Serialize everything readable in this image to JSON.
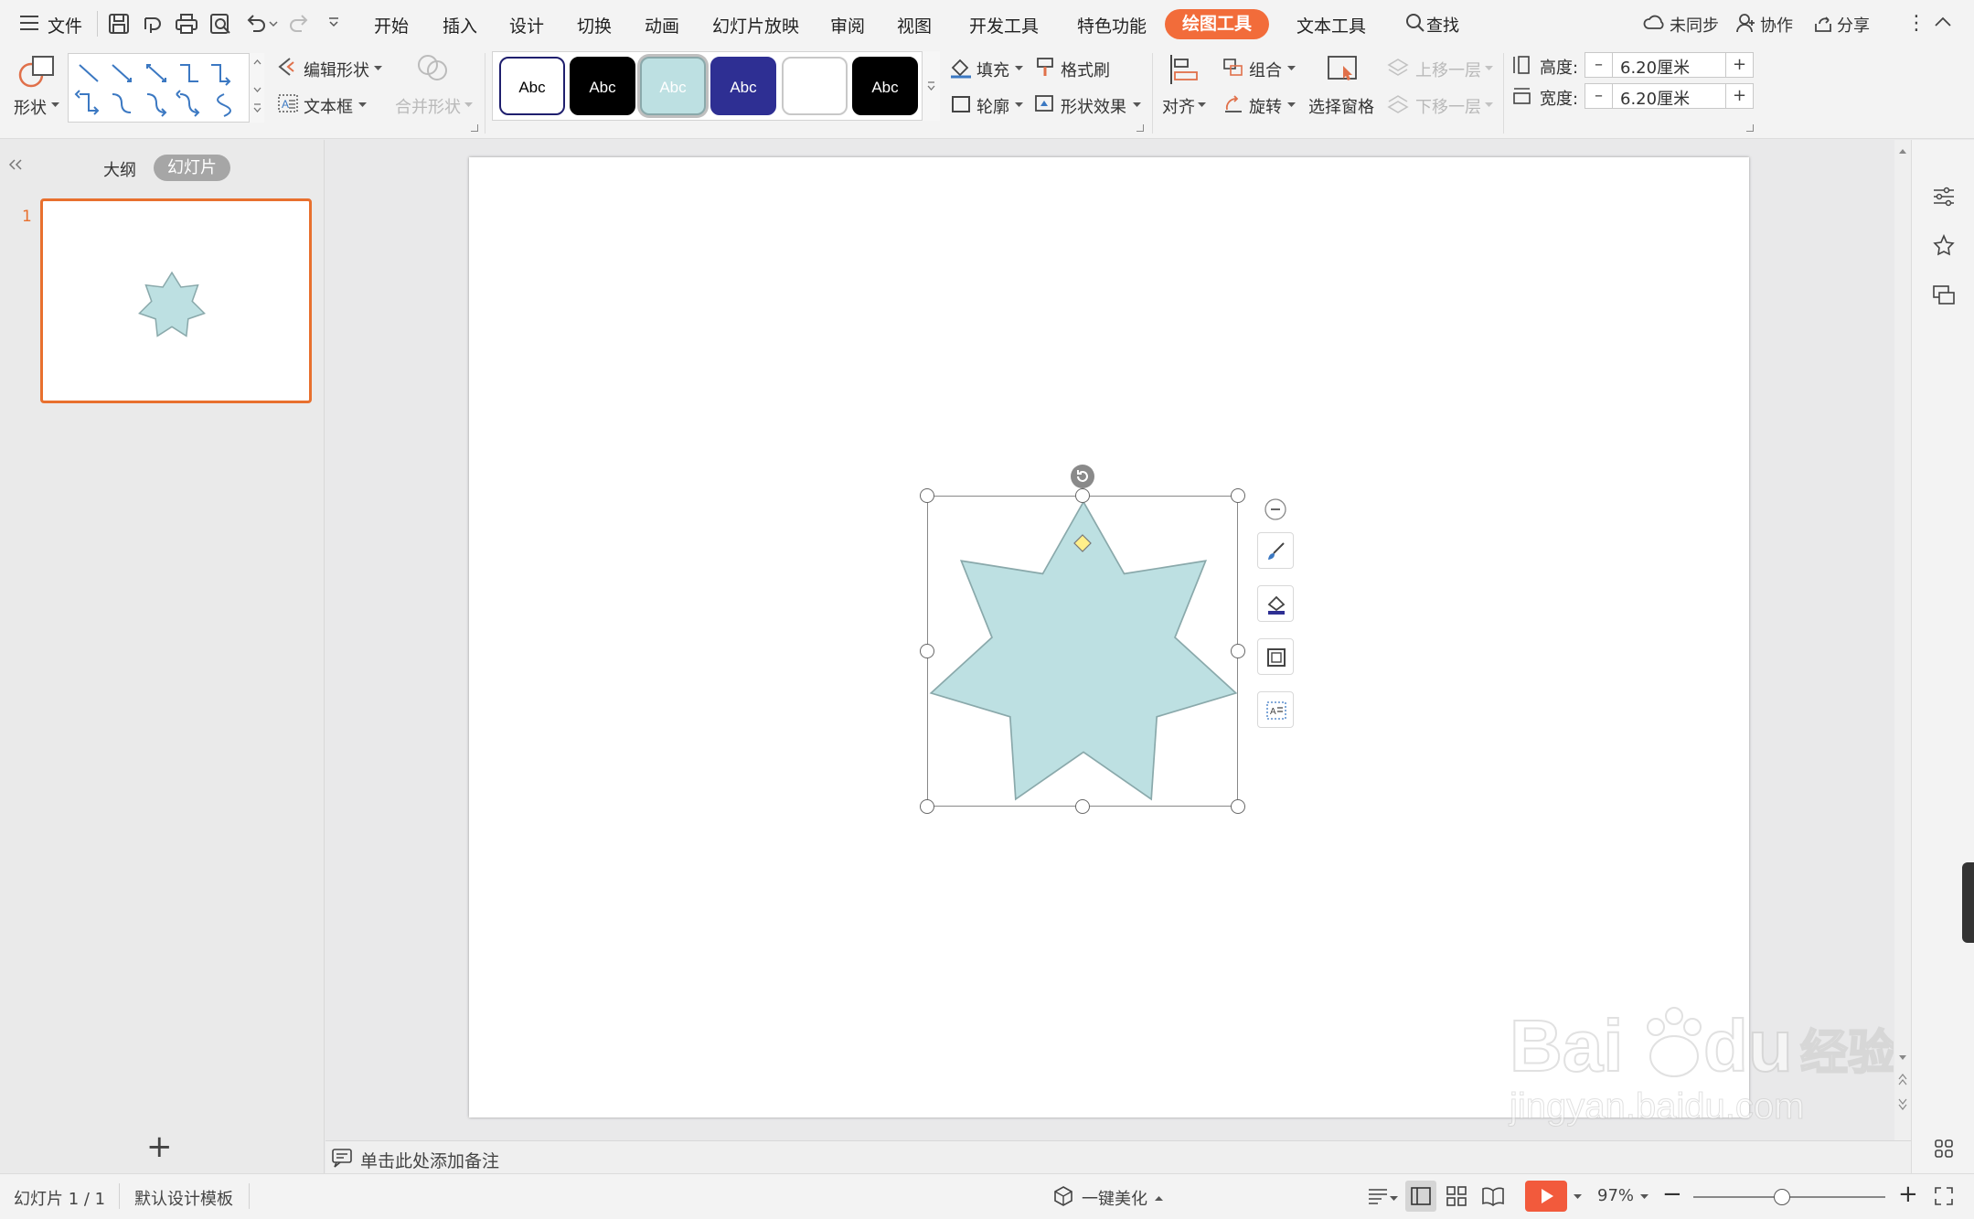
{
  "menu": {
    "file": "文件",
    "tabs": [
      "开始",
      "插入",
      "设计",
      "切换",
      "动画",
      "幻灯片放映",
      "审阅",
      "视图",
      "开发工具",
      "特色功能",
      "绘图工具",
      "文本工具"
    ],
    "search": "查找",
    "sync": "未同步",
    "collab": "协作",
    "share": "分享"
  },
  "ribbon": {
    "shape_label": "形状",
    "edit_shape": "编辑形状",
    "textbox": "文本框",
    "merge_shape": "合并形状",
    "style_preview_text": "Abc",
    "styles": [
      {
        "bg": "#ffffff",
        "fg": "#000000",
        "border": "#1f1f6e"
      },
      {
        "bg": "#000000",
        "fg": "#ffffff",
        "border": "#000000"
      },
      {
        "bg": "#bde0e2",
        "fg": "#ffffff",
        "border": "#8aa9ab"
      },
      {
        "bg": "#2e2f93",
        "fg": "#ffffff",
        "border": "#2e2f93"
      },
      {
        "bg": "#ffffff",
        "fg": "#ffffff",
        "border": "#c8c8c8"
      },
      {
        "bg": "#000000",
        "fg": "#ffffff",
        "border": "#000000"
      }
    ],
    "fill": "填充",
    "format_painter": "格式刷",
    "outline": "轮廓",
    "shape_effect": "形状效果",
    "align": "对齐",
    "group": "组合",
    "rotate": "旋转",
    "selection_pane": "选择窗格",
    "bring_forward": "上移一层",
    "send_backward": "下移一层",
    "height_label": "高度:",
    "height_value": "6.20厘米",
    "width_label": "宽度:",
    "width_value": "6.20厘米"
  },
  "left_panel": {
    "outline_tab": "大纲",
    "slides_tab": "幻灯片",
    "slide_number": "1"
  },
  "notes": {
    "placeholder": "单击此处添加备注"
  },
  "status": {
    "slide_info": "幻灯片 1 / 1",
    "template": "默认设计模板",
    "beautify": "一键美化",
    "zoom": "97%"
  },
  "watermark": {
    "logo": "Bai du 经验",
    "url": "jingyan.baidu.com"
  },
  "colors": {
    "accent": "#f26c3a",
    "star_fill": "#bde0e2",
    "star_stroke": "#8aa9ab",
    "thumb_border": "#e8702e",
    "play_button": "#f25a3c"
  }
}
